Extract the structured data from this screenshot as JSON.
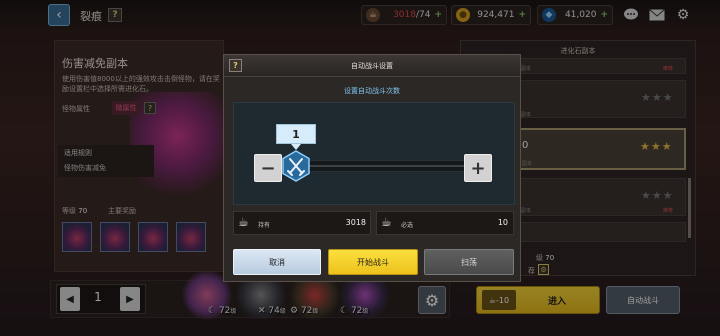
{
  "header": {
    "back_icon": "chevron-left-icon",
    "title": "裂痕",
    "help": "?",
    "resources": [
      {
        "icon": "coffee-cup-icon",
        "value": "3018/74",
        "current": "3018",
        "max": "/74"
      },
      {
        "icon": "gold-coin-icon",
        "value": "924,471"
      },
      {
        "icon": "blue-gem-icon",
        "value": "41,020"
      }
    ],
    "plus": "+"
  },
  "left_panel": {
    "title": "伤害减免副本",
    "description": "使用伤害值8000以上的强效攻击击倒怪物，请在奖励设置栏中选择所需进化石。",
    "attr_label": "怪物属性",
    "attr_value": "微属性",
    "help": "?",
    "rule_header": "适用规则",
    "rule_value": "怪物伤害减免",
    "level_label": "等级",
    "level_value": "70",
    "main_reward": "主要奖励"
  },
  "bottom": {
    "page": "1",
    "characters": [
      {
        "level": "72",
        "unit": "级"
      },
      {
        "level": "74",
        "unit": "级"
      },
      {
        "level": "72",
        "unit": "级"
      },
      {
        "level": "72",
        "unit": "级"
      }
    ]
  },
  "right_panel": {
    "title": "进化石副本",
    "rows": [
      {
        "sub": "副本",
        "red": "推荐",
        "stars": "★★★",
        "gold": false
      },
      {
        "sub": "副本",
        "stars": "★★★",
        "gold": false
      },
      {
        "prefix": "0",
        "sub": "副本",
        "stars": "★★★",
        "gold": true
      },
      {
        "sub": "副本",
        "red": "推荐",
        "stars": "★★★",
        "gold": false
      }
    ],
    "level_label": "级",
    "level_value": "70",
    "rec_label": "荐",
    "enter_cost": "-10",
    "enter_label": "进入",
    "auto_label": "自动战斗"
  },
  "modal": {
    "help": "?",
    "title": "自动战斗设置",
    "subtitle": "设置自动战斗次数",
    "count": "1",
    "minus": "−",
    "plus": "+",
    "owned_label": "持有",
    "owned_value": "3018",
    "required_label": "必选",
    "required_value": "10",
    "cancel_label": "取消",
    "start_label": "开始战斗",
    "sweep_label": "扫荡"
  },
  "colors": {
    "accent_yellow": "#f5d43a",
    "subtitle_blue": "#7fc6f0",
    "count_bg": "#d6ecfa",
    "cancel_bg": "#c8d8ea",
    "disabled_btn": "#555555",
    "star_gold": "#e8b84a"
  }
}
